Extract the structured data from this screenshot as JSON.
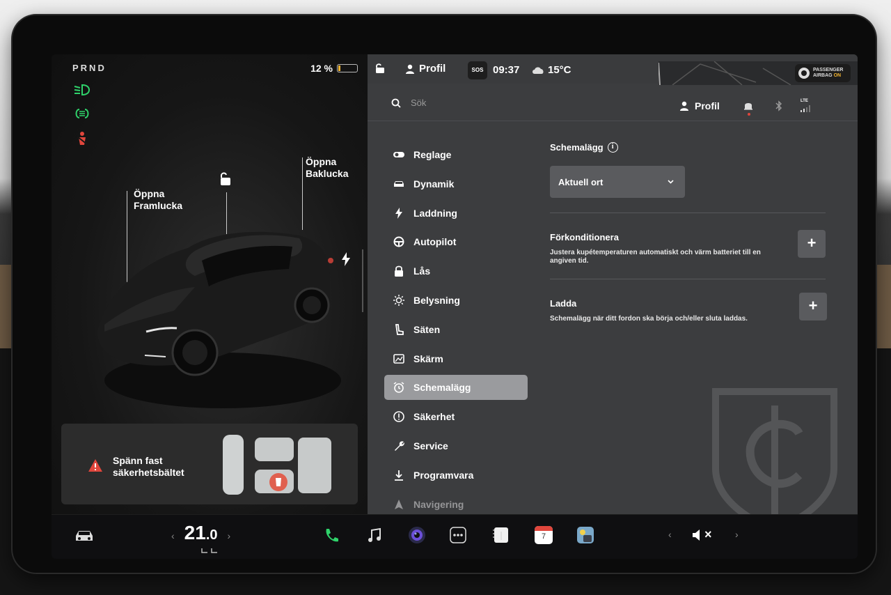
{
  "car_panel": {
    "gear": "PRND",
    "battery_percent": "12 %",
    "battery_level": 0.12,
    "label_front_trunk_1": "Öppna",
    "label_front_trunk_2": "Framlucka",
    "label_rear_trunk_1": "Öppna",
    "label_rear_trunk_2": "Baklucka",
    "seatbelt_line1": "Spänn fast",
    "seatbelt_line2": "säkerhetsbältet"
  },
  "status_bar": {
    "profile": "Profil",
    "sos": "SOS",
    "time": "09:37",
    "temperature": "15°C",
    "airbag_line1": "PASSENGER",
    "airbag_line2": "AIRBAG",
    "airbag_state": "ON"
  },
  "top_row": {
    "search_placeholder": "Sök",
    "profile": "Profil",
    "lte": "LTE"
  },
  "menu": {
    "items": [
      {
        "label": "Reglage",
        "icon": "toggle-icon"
      },
      {
        "label": "Dynamik",
        "icon": "car-icon"
      },
      {
        "label": "Laddning",
        "icon": "bolt-icon"
      },
      {
        "label": "Autopilot",
        "icon": "steering-wheel-icon"
      },
      {
        "label": "Lås",
        "icon": "lock-icon"
      },
      {
        "label": "Belysning",
        "icon": "sun-icon"
      },
      {
        "label": "Säten",
        "icon": "seat-icon"
      },
      {
        "label": "Skärm",
        "icon": "display-icon"
      },
      {
        "label": "Schemalägg",
        "icon": "alarm-clock-icon"
      },
      {
        "label": "Säkerhet",
        "icon": "alert-circle-icon"
      },
      {
        "label": "Service",
        "icon": "wrench-icon"
      },
      {
        "label": "Programvara",
        "icon": "download-icon"
      },
      {
        "label": "Navigering",
        "icon": "navigation-icon"
      }
    ]
  },
  "content": {
    "title": "Schemalägg",
    "dropdown_value": "Aktuell ort",
    "precondition_title": "Förkonditionera",
    "precondition_desc": "Justera kupétemperaturen automatiskt och värm batteriet till en angiven tid.",
    "charge_title": "Ladda",
    "charge_desc": "Schemalägg när ditt fordon ska börja och/eller sluta laddas.",
    "plus": "+"
  },
  "dock": {
    "temp_whole": "21",
    "temp_decimal": ".0",
    "left_arrow": "‹",
    "right_arrow": "›",
    "calendar_day": "7",
    "volume_mute": "×"
  },
  "colors": {
    "accent_green": "#2fd36b",
    "warning_red": "#e0463c",
    "battery_yellow": "#f2b431",
    "active_menu": "#9a9b9e"
  }
}
